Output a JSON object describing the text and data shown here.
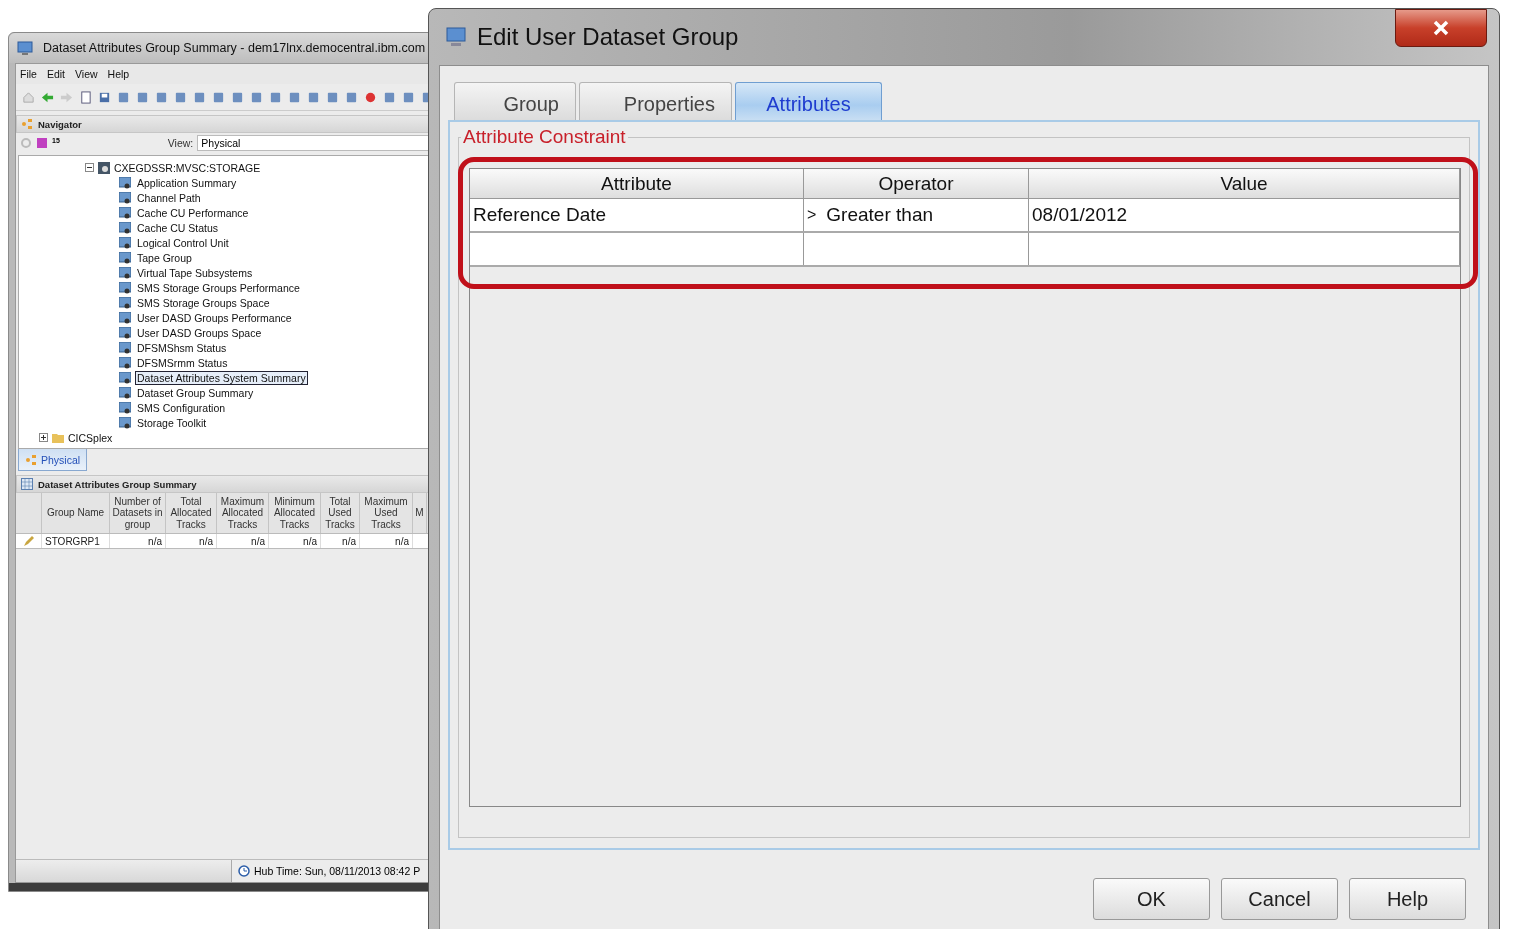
{
  "main_window": {
    "title": "Dataset Attributes Group Summary - dem17lnx.democentral.ibm.com",
    "menu": [
      {
        "label": "File"
      },
      {
        "label": "Edit"
      },
      {
        "label": "View"
      },
      {
        "label": "Help"
      }
    ],
    "navigator": {
      "title": "Navigator",
      "badge": "15",
      "view_label": "View:",
      "view_value": "Physical",
      "tree": [
        {
          "label": "CXEGDSSR:MVSC:STORAGE",
          "expanded": true,
          "children": [
            {
              "label": "Application Summary",
              "selected": false
            },
            {
              "label": "Channel Path",
              "selected": false
            },
            {
              "label": "Cache CU Performance",
              "selected": false
            },
            {
              "label": "Cache CU Status",
              "selected": false
            },
            {
              "label": "Logical Control Unit",
              "selected": false
            },
            {
              "label": "Tape Group",
              "selected": false
            },
            {
              "label": "Virtual Tape Subsystems",
              "selected": false
            },
            {
              "label": "SMS Storage Groups Performance",
              "selected": false
            },
            {
              "label": "SMS Storage Groups Space",
              "selected": false
            },
            {
              "label": "User DASD Groups Performance",
              "selected": false
            },
            {
              "label": "User DASD Groups Space",
              "selected": false
            },
            {
              "label": "DFSMShsm Status",
              "selected": false
            },
            {
              "label": "DFSMSrmm Status",
              "selected": false
            },
            {
              "label": "Dataset Attributes System Summary",
              "selected": true
            },
            {
              "label": "Dataset Group Summary",
              "selected": false
            },
            {
              "label": "SMS Configuration",
              "selected": false
            },
            {
              "label": "Storage Toolkit",
              "selected": false
            }
          ]
        },
        {
          "label": "CICSplex",
          "expanded": false
        }
      ],
      "tabs": [
        {
          "label": "Physical",
          "selected": true
        }
      ]
    },
    "table": {
      "title": "Dataset Attributes Group Summary",
      "columns": [
        "Group Name",
        "Number of Datasets in group",
        "Total Allocated Tracks",
        "Maximum Allocated Tracks",
        "Minimum Allocated Tracks",
        "Total Used Tracks",
        "Maximum Used Tracks",
        "M"
      ],
      "rows": [
        [
          "STORGRP1",
          "n/a",
          "n/a",
          "n/a",
          "n/a",
          "n/a",
          "n/a"
        ]
      ]
    },
    "status_bar": {
      "hub_time": "Hub Time: Sun, 08/11/2013 08:42 P"
    }
  },
  "dialog": {
    "title": "Edit User Dataset Group",
    "tabs": [
      {
        "label": "Group",
        "selected": false
      },
      {
        "label": "Properties",
        "selected": false
      },
      {
        "label": "Attributes",
        "selected": true
      }
    ],
    "group_title": "Attribute Constraint",
    "table": {
      "columns": [
        "Attribute",
        "Operator",
        "Value"
      ],
      "rows": [
        {
          "attribute": "Reference Date",
          "operator_symbol": ">",
          "operator": "Greater than",
          "value": "08/01/2012"
        },
        {}
      ]
    },
    "buttons": [
      {
        "label": "OK"
      },
      {
        "label": "Cancel"
      },
      {
        "label": "Help"
      }
    ]
  }
}
